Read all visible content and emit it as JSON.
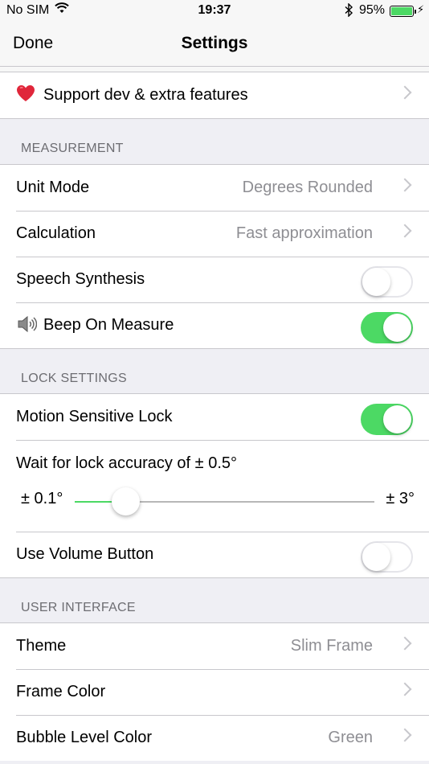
{
  "status_bar": {
    "carrier": "No SIM",
    "time": "19:37",
    "battery_percent": "95%"
  },
  "nav": {
    "done_label": "Done",
    "title": "Settings"
  },
  "support": {
    "label": "Support dev & extra features",
    "icon": "heart-icon"
  },
  "measurement": {
    "header": "MEASUREMENT",
    "unit_mode": {
      "label": "Unit Mode",
      "value": "Degrees Rounded"
    },
    "calculation": {
      "label": "Calculation",
      "value": "Fast approximation"
    },
    "speech_synthesis": {
      "label": "Speech Synthesis",
      "on": false
    },
    "beep_on_measure": {
      "label": "Beep On Measure",
      "icon": "speaker-icon",
      "on": true
    }
  },
  "lock_settings": {
    "header": "LOCK SETTINGS",
    "motion_lock": {
      "label": "Motion Sensitive Lock",
      "on": true
    },
    "accuracy": {
      "label": "Wait for lock accuracy of ± 0.5°",
      "min_label": "± 0.1°",
      "max_label": "± 3°",
      "level": 0.17
    },
    "volume_button": {
      "label": "Use Volume Button",
      "on": false
    }
  },
  "user_interface": {
    "header": "USER INTERFACE",
    "theme": {
      "label": "Theme",
      "value": "Slim Frame"
    },
    "frame_color": {
      "label": "Frame Color",
      "value": ""
    },
    "bubble_color": {
      "label": "Bubble Level Color",
      "value": "Green"
    }
  },
  "colors": {
    "accent_green": "#4cd964",
    "separator": "#c8c7cc",
    "secondary_text": "#8e8e93"
  }
}
